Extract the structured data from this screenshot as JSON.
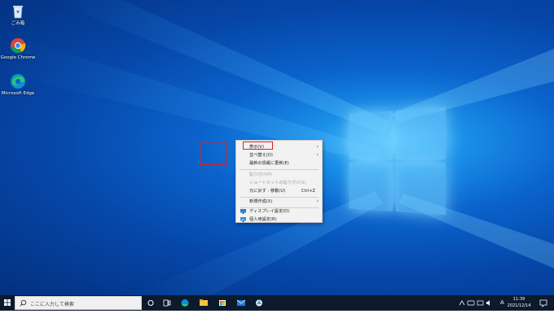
{
  "desktop": {
    "icons": [
      {
        "label": "ごみ箱",
        "icon": "recycle-bin-icon"
      },
      {
        "label": "Google Chrome",
        "icon": "chrome-icon"
      },
      {
        "label": "Microsoft Edge",
        "icon": "edge-icon"
      }
    ]
  },
  "context_menu": {
    "items": [
      {
        "label": "表示(V)",
        "submenu": true
      },
      {
        "label": "並べ替え(O)",
        "submenu": true
      },
      {
        "label": "最新の情報に更新(E)"
      },
      {
        "label": "貼り付け(P)",
        "disabled": true
      },
      {
        "label": "ショートカットの貼り付け(S)",
        "disabled": true
      },
      {
        "label": "元に戻す - 移動(U)",
        "shortcut": "Ctrl+Z"
      },
      {
        "label": "新規作成(X)",
        "submenu": true
      },
      {
        "label": "ディスプレイ設定(D)",
        "icon": "display-settings-icon"
      },
      {
        "label": "個人用設定(R)",
        "icon": "personalize-icon"
      }
    ],
    "arrow": "›"
  },
  "taskbar": {
    "search_placeholder": "ここに入力して検索",
    "ime": "A",
    "clock_time": "11:39",
    "clock_date": "2021/12/14"
  },
  "colors": {
    "accent_red": "#e0211d",
    "taskbar": "#0c1a2c"
  }
}
